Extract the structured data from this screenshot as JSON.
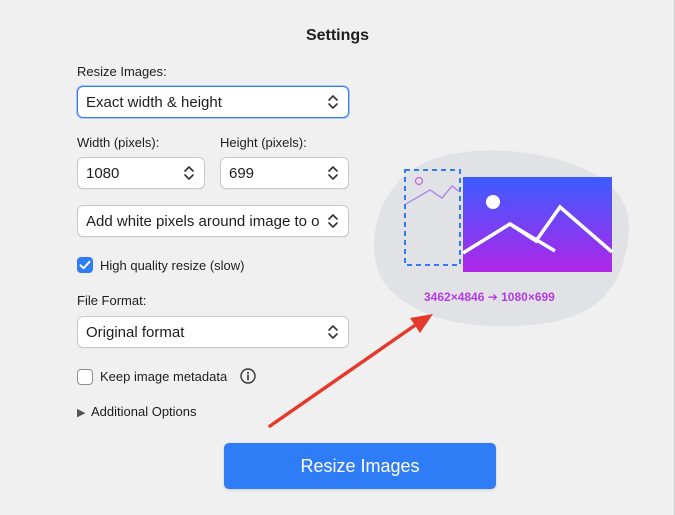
{
  "window": {
    "title": "Settings"
  },
  "resize_mode": {
    "label": "Resize Images:",
    "value": "Exact width & height"
  },
  "width": {
    "label": "Width (pixels):",
    "value": "1080"
  },
  "height": {
    "label": "Height (pixels):",
    "value": "699"
  },
  "fit_mode": {
    "value": "Add white pixels around image to o"
  },
  "high_quality": {
    "label": "High quality resize (slow)",
    "checked": true
  },
  "file_format": {
    "label": "File Format:",
    "value": "Original format"
  },
  "keep_metadata": {
    "label": "Keep image metadata",
    "checked": false
  },
  "additional_options": {
    "label": "Additional Options"
  },
  "preview": {
    "dimensions": "3462×4846 ➔ 1080×699"
  },
  "action": {
    "label": "Resize Images"
  },
  "colors": {
    "accent": "#2f7df6",
    "preview_gradient_top": "#3b5cff",
    "preview_gradient_bottom": "#b026e8",
    "arrow": "#e53a2b"
  }
}
